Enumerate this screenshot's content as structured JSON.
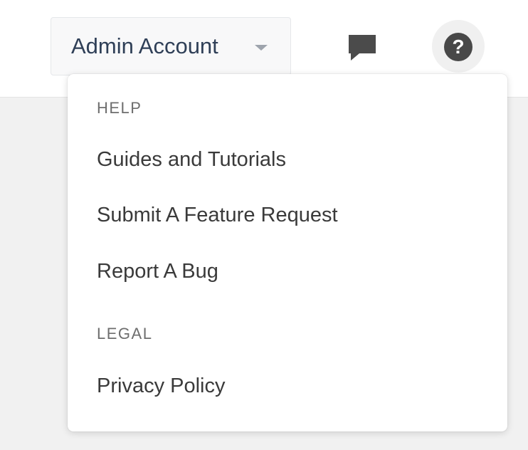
{
  "header": {
    "account_button": {
      "label": "Admin Account",
      "chevron_icon": "chevron-down-icon"
    },
    "messages_icon": "comment-icon",
    "help_icon": {
      "name": "help-icon",
      "glyph": "?"
    }
  },
  "dropdown": {
    "sections": [
      {
        "title": "HELP",
        "items": [
          "Guides and Tutorials",
          "Submit A Feature Request",
          "Report A Bug"
        ]
      },
      {
        "title": "LEGAL",
        "items": [
          "Privacy Policy"
        ]
      }
    ]
  },
  "colors": {
    "page_background": "#f1f1f1",
    "header_background": "#ffffff",
    "account_text": "#2f3f57",
    "menu_text": "#3a3a3a",
    "section_text": "#6e6e6e",
    "icon_dark": "#484848"
  }
}
